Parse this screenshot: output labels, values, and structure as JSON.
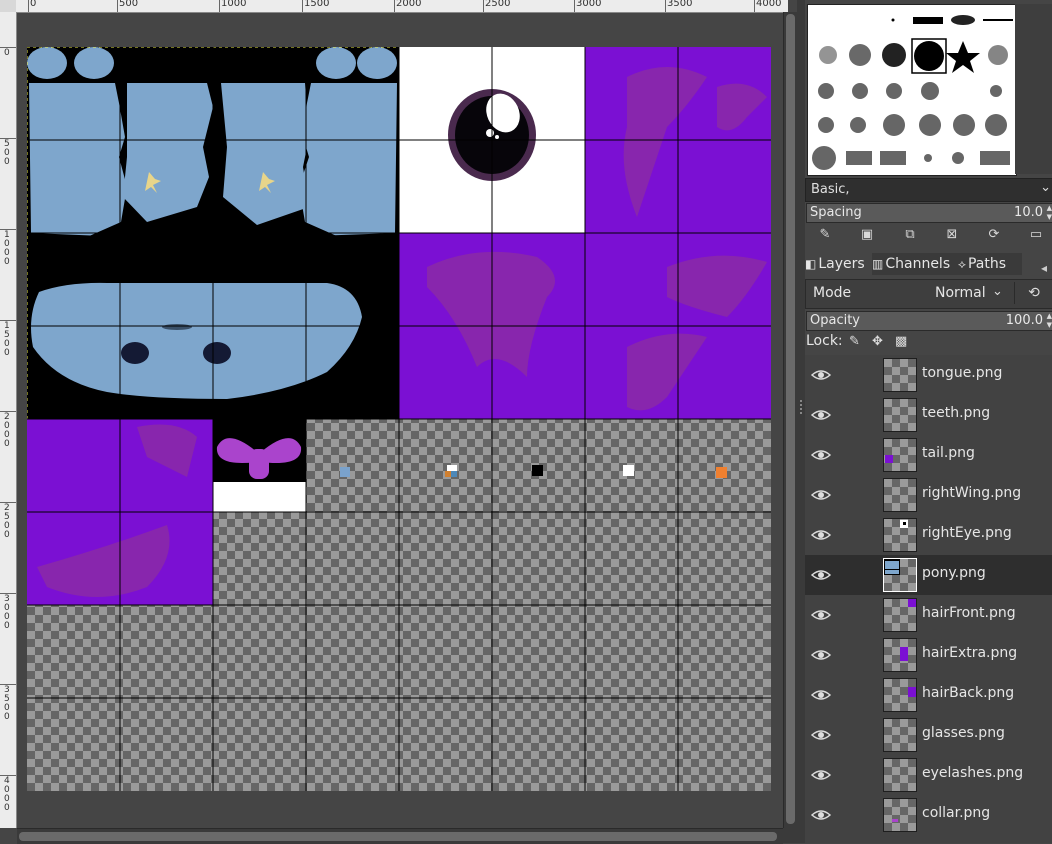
{
  "ruler": {
    "horizontal_labels": [
      "0",
      "500",
      "1000",
      "1500",
      "2000",
      "2500",
      "3000",
      "3500",
      "4000"
    ],
    "vertical_labels": [
      "0",
      "500",
      "1000",
      "1500",
      "2000",
      "2500",
      "3000",
      "3500",
      "4000"
    ]
  },
  "brushes": {
    "preset_name": "Basic,",
    "spacing_label": "Spacing",
    "spacing_value": "10.0"
  },
  "dock_tabs": [
    {
      "label": "Layers",
      "icon": "layers-icon"
    },
    {
      "label": "Channels",
      "icon": "channels-icon"
    },
    {
      "label": "Paths",
      "icon": "paths-icon"
    }
  ],
  "layer_controls": {
    "mode_label": "Mode",
    "mode_value": "Normal",
    "opacity_label": "Opacity",
    "opacity_value": "100.0",
    "lock_label": "Lock:"
  },
  "layers": [
    {
      "name": "tongue.png",
      "visible": true,
      "active": false
    },
    {
      "name": "teeth.png",
      "visible": true,
      "active": false
    },
    {
      "name": "tail.png",
      "visible": true,
      "active": false
    },
    {
      "name": "rightWing.png",
      "visible": true,
      "active": false
    },
    {
      "name": "rightEye.png",
      "visible": true,
      "active": false
    },
    {
      "name": "pony.png",
      "visible": true,
      "active": true
    },
    {
      "name": "hairFront.png",
      "visible": true,
      "active": false
    },
    {
      "name": "hairExtra.png",
      "visible": true,
      "active": false
    },
    {
      "name": "hairBack.png",
      "visible": true,
      "active": false
    },
    {
      "name": "glasses.png",
      "visible": true,
      "active": false
    },
    {
      "name": "eyelashes.png",
      "visible": true,
      "active": false
    },
    {
      "name": "collar.png",
      "visible": true,
      "active": false
    }
  ],
  "colors": {
    "body": "#7ea6cc",
    "hair": "#7b10d3",
    "hair_shade": "#8b2aa6",
    "bow": "#aa44cc",
    "active_layer": "#2e2e2e"
  }
}
